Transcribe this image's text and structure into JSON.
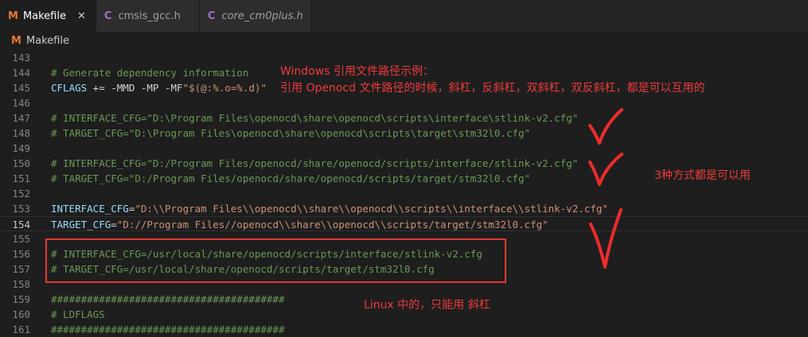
{
  "tabs": [
    {
      "label": "Makefile",
      "icon": "M",
      "active": true,
      "close": "✕"
    },
    {
      "label": "cmsis_gcc.h",
      "icon": "C",
      "active": false
    },
    {
      "label": "core_cm0plus.h",
      "icon": "C",
      "active": false,
      "italic": true
    }
  ],
  "breadcrumb": {
    "icon": "M",
    "label": "Makefile"
  },
  "lines": [
    {
      "num": "143"
    },
    {
      "num": "144",
      "segments": [
        {
          "t": "# Generate dependency information",
          "c": "cmt"
        }
      ]
    },
    {
      "num": "145",
      "segments": [
        {
          "t": "CFLAGS",
          "c": "var"
        },
        {
          "t": " += -MMD -MP -MF",
          "c": "op"
        },
        {
          "t": "\"$(@:%.o=%.d)\"",
          "c": "str"
        }
      ]
    },
    {
      "num": "146"
    },
    {
      "num": "147",
      "segments": [
        {
          "t": "# INTERFACE_CFG=\"D:\\Program Files\\openocd\\share\\openocd\\scripts\\interface\\stlink-v2.cfg\"",
          "c": "cmt"
        }
      ]
    },
    {
      "num": "148",
      "segments": [
        {
          "t": "# TARGET_CFG=\"D:\\Program Files\\openocd\\share\\openocd\\scripts\\target\\stm32l0.cfg\"",
          "c": "cmt"
        }
      ]
    },
    {
      "num": "149"
    },
    {
      "num": "150",
      "segments": [
        {
          "t": "# INTERFACE_CFG=\"D:/Program Files/openocd/share/openocd/scripts/interface/stlink-v2.cfg\"",
          "c": "cmt"
        }
      ]
    },
    {
      "num": "151",
      "segments": [
        {
          "t": "# TARGET_CFG=\"D:/Program Files/openocd/share/openocd/scripts/target/stm32l0.cfg\"",
          "c": "cmt"
        }
      ]
    },
    {
      "num": "152"
    },
    {
      "num": "153",
      "segments": [
        {
          "t": "INTERFACE_CFG",
          "c": "var"
        },
        {
          "t": "=",
          "c": "op"
        },
        {
          "t": "\"D:\\\\Program Files\\\\openocd\\\\share\\\\openocd\\\\scripts\\\\interface\\\\stlink-v2.cfg\"",
          "c": "str"
        }
      ]
    },
    {
      "num": "154",
      "current": true,
      "segments": [
        {
          "t": "TARGET_CFG",
          "c": "var"
        },
        {
          "t": "=",
          "c": "op"
        },
        {
          "t": "\"D://Program Files//openocd\\\\share\\\\openocd\\\\scripts/target/stm32l0.cfg\"",
          "c": "str"
        }
      ]
    },
    {
      "num": "155"
    },
    {
      "num": "156",
      "segments": [
        {
          "t": "# INTERFACE_CFG=/usr/local/share/openocd/scripts/interface/stlink-v2.cfg",
          "c": "cmt"
        }
      ]
    },
    {
      "num": "157",
      "segments": [
        {
          "t": "# TARGET_CFG=/usr/local/share/openocd/scripts/target/stm32l0.cfg",
          "c": "cmt"
        }
      ]
    },
    {
      "num": "158"
    },
    {
      "num": "159",
      "segments": [
        {
          "t": "#######################################",
          "c": "cmt"
        }
      ]
    },
    {
      "num": "160",
      "segments": [
        {
          "t": "# LDFLAGS",
          "c": "cmt"
        }
      ]
    },
    {
      "num": "161",
      "segments": [
        {
          "t": "#######################################",
          "c": "cmt"
        }
      ]
    }
  ],
  "annotations": {
    "windows_title": "Windows 引用文件路径示例：",
    "windows_desc": "引用 Openocd 文件路径的时候，斜杠，反斜杠，双斜杠，双反斜杠，都是可以互用的",
    "three_ways": "3种方式都是可以用",
    "linux_note": "Linux 中的，只能用 斜杠"
  },
  "colors": {
    "annotation_red": "#f03a3a",
    "comment": "#6a9955",
    "variable": "#9cdcfe",
    "string": "#ce9178"
  }
}
